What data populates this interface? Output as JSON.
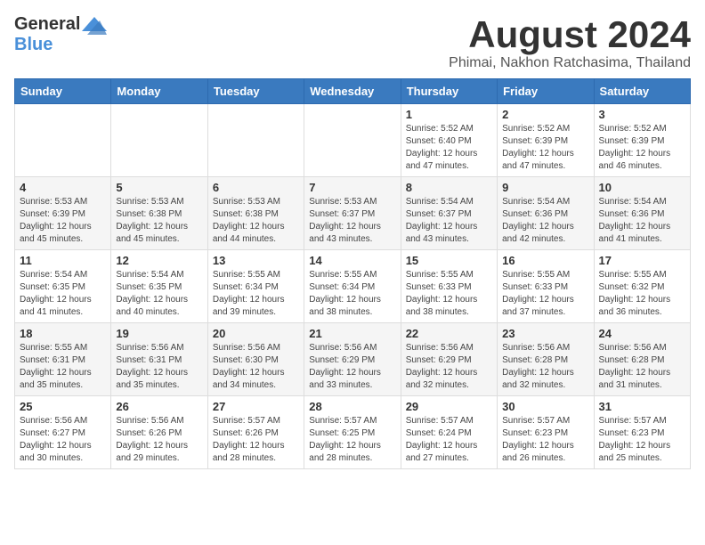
{
  "header": {
    "logo_general": "General",
    "logo_blue": "Blue",
    "month_title": "August 2024",
    "location": "Phimai, Nakhon Ratchasima, Thailand"
  },
  "weekdays": [
    "Sunday",
    "Monday",
    "Tuesday",
    "Wednesday",
    "Thursday",
    "Friday",
    "Saturday"
  ],
  "weeks": [
    {
      "days": [
        {
          "num": "",
          "info": ""
        },
        {
          "num": "",
          "info": ""
        },
        {
          "num": "",
          "info": ""
        },
        {
          "num": "",
          "info": ""
        },
        {
          "num": "1",
          "info": "Sunrise: 5:52 AM\nSunset: 6:40 PM\nDaylight: 12 hours\nand 47 minutes."
        },
        {
          "num": "2",
          "info": "Sunrise: 5:52 AM\nSunset: 6:39 PM\nDaylight: 12 hours\nand 47 minutes."
        },
        {
          "num": "3",
          "info": "Sunrise: 5:52 AM\nSunset: 6:39 PM\nDaylight: 12 hours\nand 46 minutes."
        }
      ]
    },
    {
      "days": [
        {
          "num": "4",
          "info": "Sunrise: 5:53 AM\nSunset: 6:39 PM\nDaylight: 12 hours\nand 45 minutes."
        },
        {
          "num": "5",
          "info": "Sunrise: 5:53 AM\nSunset: 6:38 PM\nDaylight: 12 hours\nand 45 minutes."
        },
        {
          "num": "6",
          "info": "Sunrise: 5:53 AM\nSunset: 6:38 PM\nDaylight: 12 hours\nand 44 minutes."
        },
        {
          "num": "7",
          "info": "Sunrise: 5:53 AM\nSunset: 6:37 PM\nDaylight: 12 hours\nand 43 minutes."
        },
        {
          "num": "8",
          "info": "Sunrise: 5:54 AM\nSunset: 6:37 PM\nDaylight: 12 hours\nand 43 minutes."
        },
        {
          "num": "9",
          "info": "Sunrise: 5:54 AM\nSunset: 6:36 PM\nDaylight: 12 hours\nand 42 minutes."
        },
        {
          "num": "10",
          "info": "Sunrise: 5:54 AM\nSunset: 6:36 PM\nDaylight: 12 hours\nand 41 minutes."
        }
      ]
    },
    {
      "days": [
        {
          "num": "11",
          "info": "Sunrise: 5:54 AM\nSunset: 6:35 PM\nDaylight: 12 hours\nand 41 minutes."
        },
        {
          "num": "12",
          "info": "Sunrise: 5:54 AM\nSunset: 6:35 PM\nDaylight: 12 hours\nand 40 minutes."
        },
        {
          "num": "13",
          "info": "Sunrise: 5:55 AM\nSunset: 6:34 PM\nDaylight: 12 hours\nand 39 minutes."
        },
        {
          "num": "14",
          "info": "Sunrise: 5:55 AM\nSunset: 6:34 PM\nDaylight: 12 hours\nand 38 minutes."
        },
        {
          "num": "15",
          "info": "Sunrise: 5:55 AM\nSunset: 6:33 PM\nDaylight: 12 hours\nand 38 minutes."
        },
        {
          "num": "16",
          "info": "Sunrise: 5:55 AM\nSunset: 6:33 PM\nDaylight: 12 hours\nand 37 minutes."
        },
        {
          "num": "17",
          "info": "Sunrise: 5:55 AM\nSunset: 6:32 PM\nDaylight: 12 hours\nand 36 minutes."
        }
      ]
    },
    {
      "days": [
        {
          "num": "18",
          "info": "Sunrise: 5:55 AM\nSunset: 6:31 PM\nDaylight: 12 hours\nand 35 minutes."
        },
        {
          "num": "19",
          "info": "Sunrise: 5:56 AM\nSunset: 6:31 PM\nDaylight: 12 hours\nand 35 minutes."
        },
        {
          "num": "20",
          "info": "Sunrise: 5:56 AM\nSunset: 6:30 PM\nDaylight: 12 hours\nand 34 minutes."
        },
        {
          "num": "21",
          "info": "Sunrise: 5:56 AM\nSunset: 6:29 PM\nDaylight: 12 hours\nand 33 minutes."
        },
        {
          "num": "22",
          "info": "Sunrise: 5:56 AM\nSunset: 6:29 PM\nDaylight: 12 hours\nand 32 minutes."
        },
        {
          "num": "23",
          "info": "Sunrise: 5:56 AM\nSunset: 6:28 PM\nDaylight: 12 hours\nand 32 minutes."
        },
        {
          "num": "24",
          "info": "Sunrise: 5:56 AM\nSunset: 6:28 PM\nDaylight: 12 hours\nand 31 minutes."
        }
      ]
    },
    {
      "days": [
        {
          "num": "25",
          "info": "Sunrise: 5:56 AM\nSunset: 6:27 PM\nDaylight: 12 hours\nand 30 minutes."
        },
        {
          "num": "26",
          "info": "Sunrise: 5:56 AM\nSunset: 6:26 PM\nDaylight: 12 hours\nand 29 minutes."
        },
        {
          "num": "27",
          "info": "Sunrise: 5:57 AM\nSunset: 6:26 PM\nDaylight: 12 hours\nand 28 minutes."
        },
        {
          "num": "28",
          "info": "Sunrise: 5:57 AM\nSunset: 6:25 PM\nDaylight: 12 hours\nand 28 minutes."
        },
        {
          "num": "29",
          "info": "Sunrise: 5:57 AM\nSunset: 6:24 PM\nDaylight: 12 hours\nand 27 minutes."
        },
        {
          "num": "30",
          "info": "Sunrise: 5:57 AM\nSunset: 6:23 PM\nDaylight: 12 hours\nand 26 minutes."
        },
        {
          "num": "31",
          "info": "Sunrise: 5:57 AM\nSunset: 6:23 PM\nDaylight: 12 hours\nand 25 minutes."
        }
      ]
    }
  ]
}
